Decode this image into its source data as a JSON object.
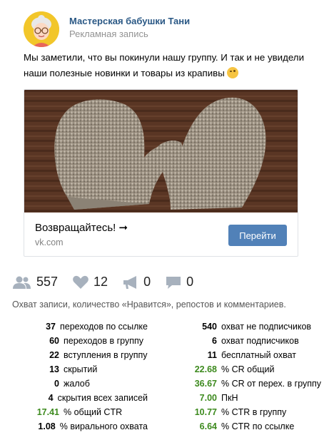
{
  "post": {
    "group_name": "Мастерская бабушки Тани",
    "ad_label": "Рекламная запись",
    "text": "Мы заметили, что вы покинули нашу группу. И так и не увидели наши полезные новинки и товары из крапивы",
    "emoji_icon": "winking-face-icon"
  },
  "card": {
    "title": "Возвращайтесь! ➞",
    "domain": "vk.com",
    "button_label": "Перейти"
  },
  "stats": {
    "reach": "557",
    "likes": "12",
    "reposts": "0",
    "comments": "0",
    "caption": "Охват записи, количество «Нравится», репостов и комментариев."
  },
  "metrics_left": [
    {
      "value": "37",
      "label": "переходов по ссылке",
      "color": "#000000"
    },
    {
      "value": "60",
      "label": "переходов в группу",
      "color": "#000000"
    },
    {
      "value": "22",
      "label": "вступления в группу",
      "color": "#000000"
    },
    {
      "value": "13",
      "label": "скрытий",
      "color": "#000000"
    },
    {
      "value": "0",
      "label": "жалоб",
      "color": "#000000"
    },
    {
      "value": "4",
      "label": "скрытия всех записей",
      "color": "#000000"
    },
    {
      "value": "17.41",
      "label": "% общий CTR",
      "color": "#3d8a1e"
    },
    {
      "value": "1.08",
      "label": "% вирального охвата",
      "color": "#000000"
    }
  ],
  "metrics_right": [
    {
      "value": "540",
      "label": "охват не подписчиков",
      "color": "#000000"
    },
    {
      "value": "6",
      "label": "охват подписчиков",
      "color": "#000000"
    },
    {
      "value": "11",
      "label": "бесплатный охват",
      "color": "#000000"
    },
    {
      "value": "22.68",
      "label": "% CR общий",
      "color": "#3d8a1e"
    },
    {
      "value": "36.67",
      "label": "% CR от перех. в группу",
      "color": "#3d8a1e"
    },
    {
      "value": "7.00",
      "label": "ПкН",
      "color": "#3d8a1e"
    },
    {
      "value": "10.77",
      "label": "% CTR в группу",
      "color": "#3d8a1e"
    },
    {
      "value": "6.64",
      "label": "% CTR по ссылке",
      "color": "#3d8a1e"
    }
  ],
  "colors": {
    "link": "#2a5885",
    "button": "#5181b8",
    "positive": "#3d8a1e",
    "icon_gray": "#a7b1bd"
  }
}
